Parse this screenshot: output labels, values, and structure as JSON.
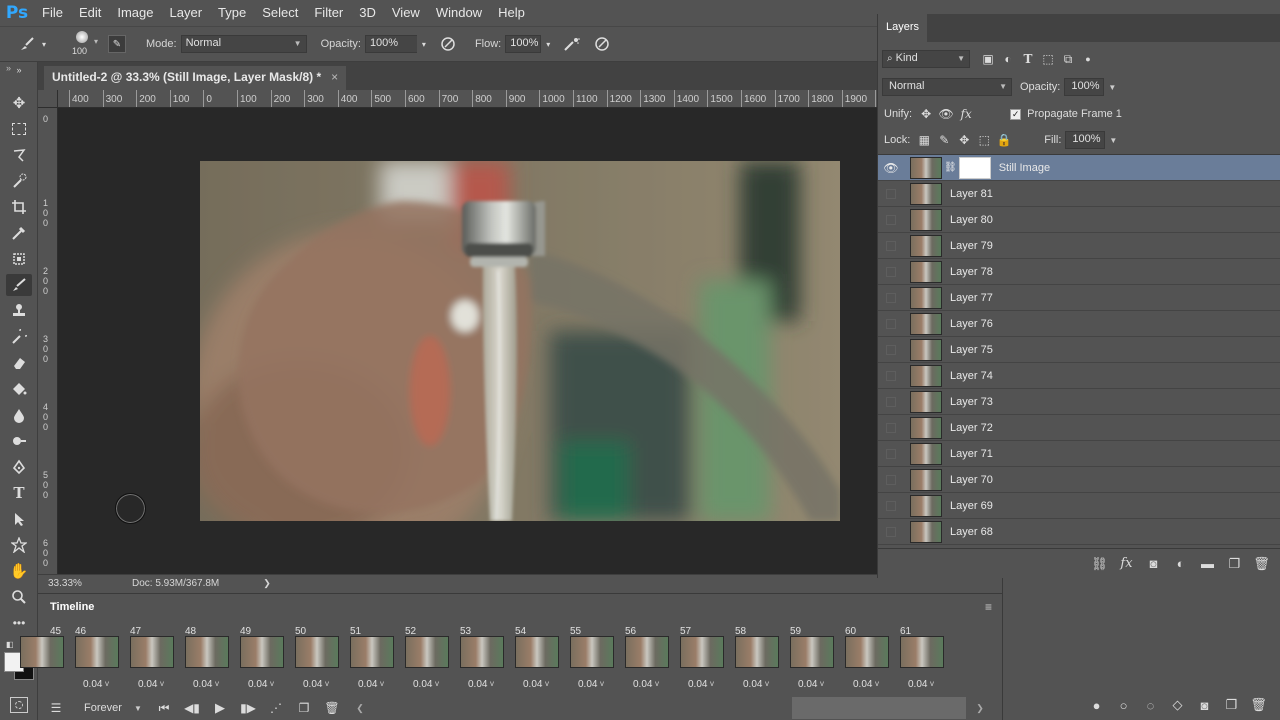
{
  "app": {
    "logo": "Ps"
  },
  "menu": [
    "File",
    "Edit",
    "Image",
    "Layer",
    "Type",
    "Select",
    "Filter",
    "3D",
    "View",
    "Window",
    "Help"
  ],
  "options_bar": {
    "brush_size": "100",
    "mode_label": "Mode:",
    "mode_value": "Normal",
    "opacity_label": "Opacity:",
    "opacity_value": "100%",
    "flow_label": "Flow:",
    "flow_value": "100%"
  },
  "document": {
    "tab_title": "Untitled-2 @ 33.3% (Still Image, Layer Mask/8) *",
    "close_glyph": "×"
  },
  "ruler_h": [
    "400",
    "300",
    "200",
    "100",
    "0",
    "100",
    "200",
    "300",
    "400",
    "500",
    "600",
    "700",
    "800",
    "900",
    "1000",
    "1100",
    "1200",
    "1300",
    "1400",
    "1500",
    "1600",
    "1700",
    "1800",
    "1900",
    "2"
  ],
  "status": {
    "zoom": "33.33%",
    "doc": "Doc: 5.93M/367.8M",
    "arrow": "❯"
  },
  "timeline": {
    "title": "Timeline",
    "frames": [
      {
        "num": "",
        "delay": ""
      },
      {
        "num": "46",
        "delay": "0.04"
      },
      {
        "num": "47",
        "delay": "0.04"
      },
      {
        "num": "48",
        "delay": "0.04"
      },
      {
        "num": "49",
        "delay": "0.04"
      },
      {
        "num": "50",
        "delay": "0.04"
      },
      {
        "num": "51",
        "delay": "0.04"
      },
      {
        "num": "52",
        "delay": "0.04"
      },
      {
        "num": "53",
        "delay": "0.04"
      },
      {
        "num": "54",
        "delay": "0.04"
      },
      {
        "num": "55",
        "delay": "0.04"
      },
      {
        "num": "56",
        "delay": "0.04"
      },
      {
        "num": "57",
        "delay": "0.04"
      },
      {
        "num": "58",
        "delay": "0.04"
      },
      {
        "num": "59",
        "delay": "0.04"
      },
      {
        "num": "60",
        "delay": "0.04"
      },
      {
        "num": "61",
        "delay": "0.04"
      }
    ],
    "first_frame_num": "45",
    "loop": "Forever"
  },
  "layers_panel": {
    "tab": "Layers",
    "filter_kind": "Kind",
    "blend_mode": "Normal",
    "opacity_label": "Opacity:",
    "opacity_value": "100%",
    "unify_label": "Unify:",
    "propagate_label": "Propagate Frame 1",
    "lock_label": "Lock:",
    "fill_label": "Fill:",
    "fill_value": "100%",
    "layers": [
      {
        "name": "Still Image",
        "visible": true,
        "selected": true,
        "mask": true
      },
      {
        "name": "Layer 81",
        "visible": false,
        "selected": false,
        "mask": false
      },
      {
        "name": "Layer 80",
        "visible": false,
        "selected": false,
        "mask": false
      },
      {
        "name": "Layer 79",
        "visible": false,
        "selected": false,
        "mask": false
      },
      {
        "name": "Layer 78",
        "visible": false,
        "selected": false,
        "mask": false
      },
      {
        "name": "Layer 77",
        "visible": false,
        "selected": false,
        "mask": false
      },
      {
        "name": "Layer 76",
        "visible": false,
        "selected": false,
        "mask": false
      },
      {
        "name": "Layer 75",
        "visible": false,
        "selected": false,
        "mask": false
      },
      {
        "name": "Layer 74",
        "visible": false,
        "selected": false,
        "mask": false
      },
      {
        "name": "Layer 73",
        "visible": false,
        "selected": false,
        "mask": false
      },
      {
        "name": "Layer 72",
        "visible": false,
        "selected": false,
        "mask": false
      },
      {
        "name": "Layer 71",
        "visible": false,
        "selected": false,
        "mask": false
      },
      {
        "name": "Layer 70",
        "visible": false,
        "selected": false,
        "mask": false
      },
      {
        "name": "Layer 69",
        "visible": false,
        "selected": false,
        "mask": false
      },
      {
        "name": "Layer 68",
        "visible": false,
        "selected": false,
        "mask": false
      }
    ]
  },
  "colors": {
    "accent": "#31a8ff",
    "selected_layer": "#6a7d99",
    "panel_bg": "#535353",
    "canvas_bg": "#282828"
  }
}
